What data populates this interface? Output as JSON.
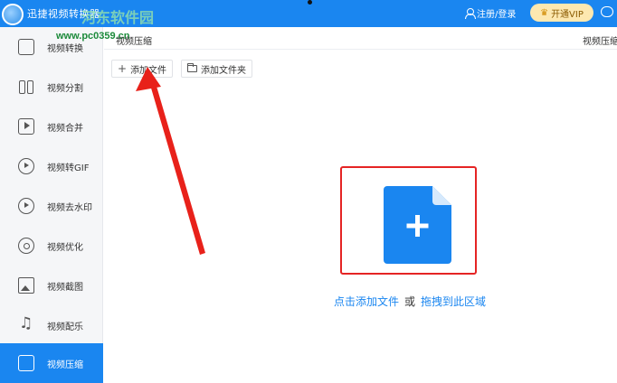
{
  "app": {
    "title": "迅捷视频转换器",
    "watermark_top": "河东软件园",
    "watermark_url": "www.pc0359.cn"
  },
  "header": {
    "login_label": "注册/登录",
    "vip_label": "开通VIP",
    "icons": [
      "user-icon",
      "crown-icon",
      "message-icon"
    ]
  },
  "sidebar": {
    "items": [
      {
        "label": "视频转换",
        "icon": "video-convert-icon"
      },
      {
        "label": "视频分割",
        "icon": "split-icon"
      },
      {
        "label": "视频合并",
        "icon": "merge-icon"
      },
      {
        "label": "视频转GIF",
        "icon": "gif-icon"
      },
      {
        "label": "视频去水印",
        "icon": "watermark-remove-icon"
      },
      {
        "label": "视频优化",
        "icon": "optimize-icon"
      },
      {
        "label": "视频截图",
        "icon": "screenshot-icon"
      },
      {
        "label": "视频配乐",
        "icon": "music-icon"
      },
      {
        "label": "视频压缩",
        "icon": "compress-icon"
      }
    ],
    "active_index": 8,
    "active_color": "#1a86f0"
  },
  "main": {
    "sub_tab": "视频压缩",
    "right_label": "视频压缩：",
    "add_file_label": "添加文件",
    "add_folder_label": "添加文件夹",
    "drop_hint_click": "点击添加文件",
    "drop_hint_or": "或",
    "drop_hint_drag": "拖拽到此区域"
  },
  "colors": {
    "accent": "#1a86f0",
    "highlight_box": "#e52424",
    "vip_bg": "#fde8b0"
  }
}
